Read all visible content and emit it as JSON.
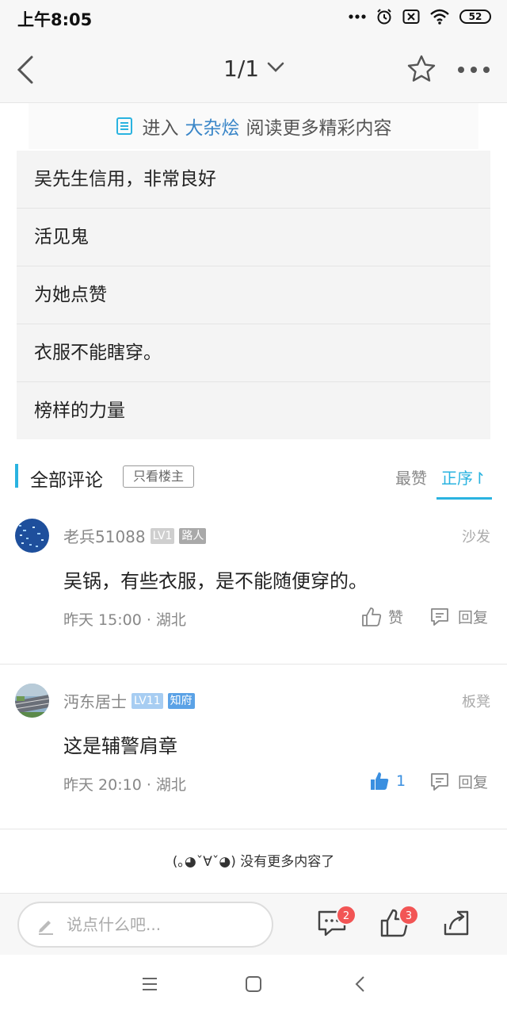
{
  "status_bar": {
    "time": "上午8:05",
    "battery": "52",
    "icons": [
      "dots-icon",
      "alarm-icon",
      "sim-off-icon",
      "wifi-icon",
      "battery-icon"
    ]
  },
  "nav": {
    "page_indicator": "1/1"
  },
  "promo": {
    "prefix": "进入",
    "link": "大杂烩",
    "suffix": "阅读更多精彩内容"
  },
  "related_items": [
    "吴先生信用，非常良好",
    "活见鬼",
    "为她点赞",
    "衣服不能瞎穿。",
    "榜样的力量"
  ],
  "comments_header": {
    "title": "全部评论",
    "owner_only": "只看楼主",
    "sort_hot": "最赞",
    "sort_order": "正序↾"
  },
  "comments": [
    {
      "user": "老兵51088",
      "level": "LV1",
      "title": "路人",
      "floor": "沙发",
      "text": "吴锅，有些衣服，是不能随便穿的。",
      "meta": "昨天 15:00 · 湖北",
      "like_label": "赞",
      "reply_label": "回复"
    },
    {
      "user": "沔东居士",
      "level": "LV11",
      "title": "知府",
      "floor": "板凳",
      "text": "这是辅警肩章",
      "meta": "昨天 20:10 · 湖北",
      "like_label": "1",
      "reply_label": "回复"
    }
  ],
  "no_more": "(｡◕ˇ∀ˇ◕) 没有更多内容了",
  "bottom": {
    "placeholder": "说点什么吧...",
    "comment_badge": "2",
    "like_badge": "3"
  },
  "colors": {
    "accent": "#2ab3e0",
    "link": "#3a86c8",
    "badge": "#f25555",
    "liked": "#3a8fe0"
  }
}
